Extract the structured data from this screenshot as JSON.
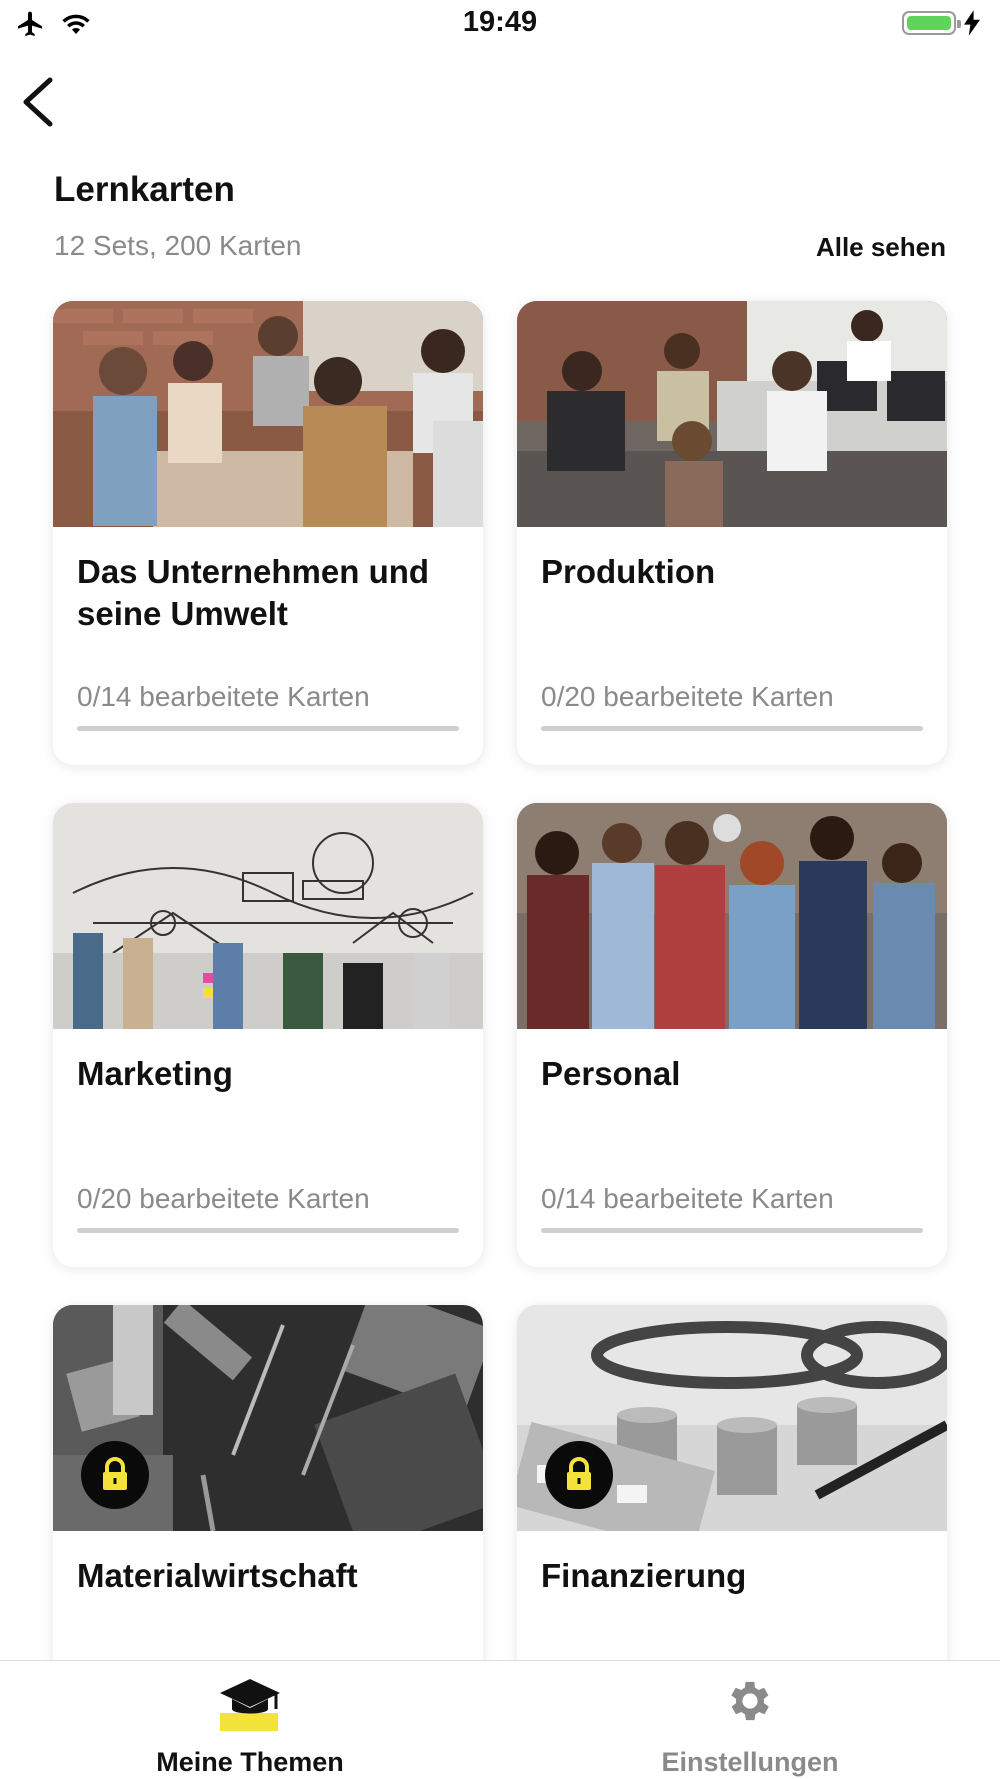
{
  "status_bar": {
    "time": "19:49",
    "icons": [
      "airplane-icon",
      "wifi-icon",
      "battery-icon",
      "charging-bolt-icon"
    ]
  },
  "header": {
    "back_icon": "chevron-left-icon",
    "title": "Lernkarten",
    "subtitle": "12 Sets, 200 Karten",
    "see_all": "Alle sehen"
  },
  "cards": [
    {
      "title": "Das Unternehmen und seine Umwelt",
      "progress_label": "0/14 bearbeitete Karten",
      "progress": 0,
      "locked": false,
      "image": "business-meeting-photo"
    },
    {
      "title": "Produktion",
      "progress_label": "0/20 bearbeitete Karten",
      "progress": 0,
      "locked": false,
      "image": "office-workers-photo"
    },
    {
      "title": "Marketing",
      "progress_label": "0/20 bearbeitete Karten",
      "progress": 0,
      "locked": false,
      "image": "marketing-sketch-photo"
    },
    {
      "title": "Personal",
      "progress_label": "0/14 bearbeitete Karten",
      "progress": 0,
      "locked": false,
      "image": "team-group-photo"
    },
    {
      "title": "Materialwirtschaft",
      "progress_label": "",
      "progress": 0,
      "locked": true,
      "image": "tools-materials-photo"
    },
    {
      "title": "Finanzierung",
      "progress_label": "",
      "progress": 0,
      "locked": true,
      "image": "coins-calculator-photo"
    }
  ],
  "tabbar": {
    "tabs": [
      {
        "label": "Meine Themen",
        "icon": "graduation-cap-icon",
        "active": true
      },
      {
        "label": "Einstellungen",
        "icon": "gear-icon",
        "active": false
      }
    ]
  },
  "colors": {
    "accent": "#F2E23A",
    "text_primary": "#111111",
    "text_secondary": "#8A8A8A",
    "background": "#FFFFFF"
  }
}
